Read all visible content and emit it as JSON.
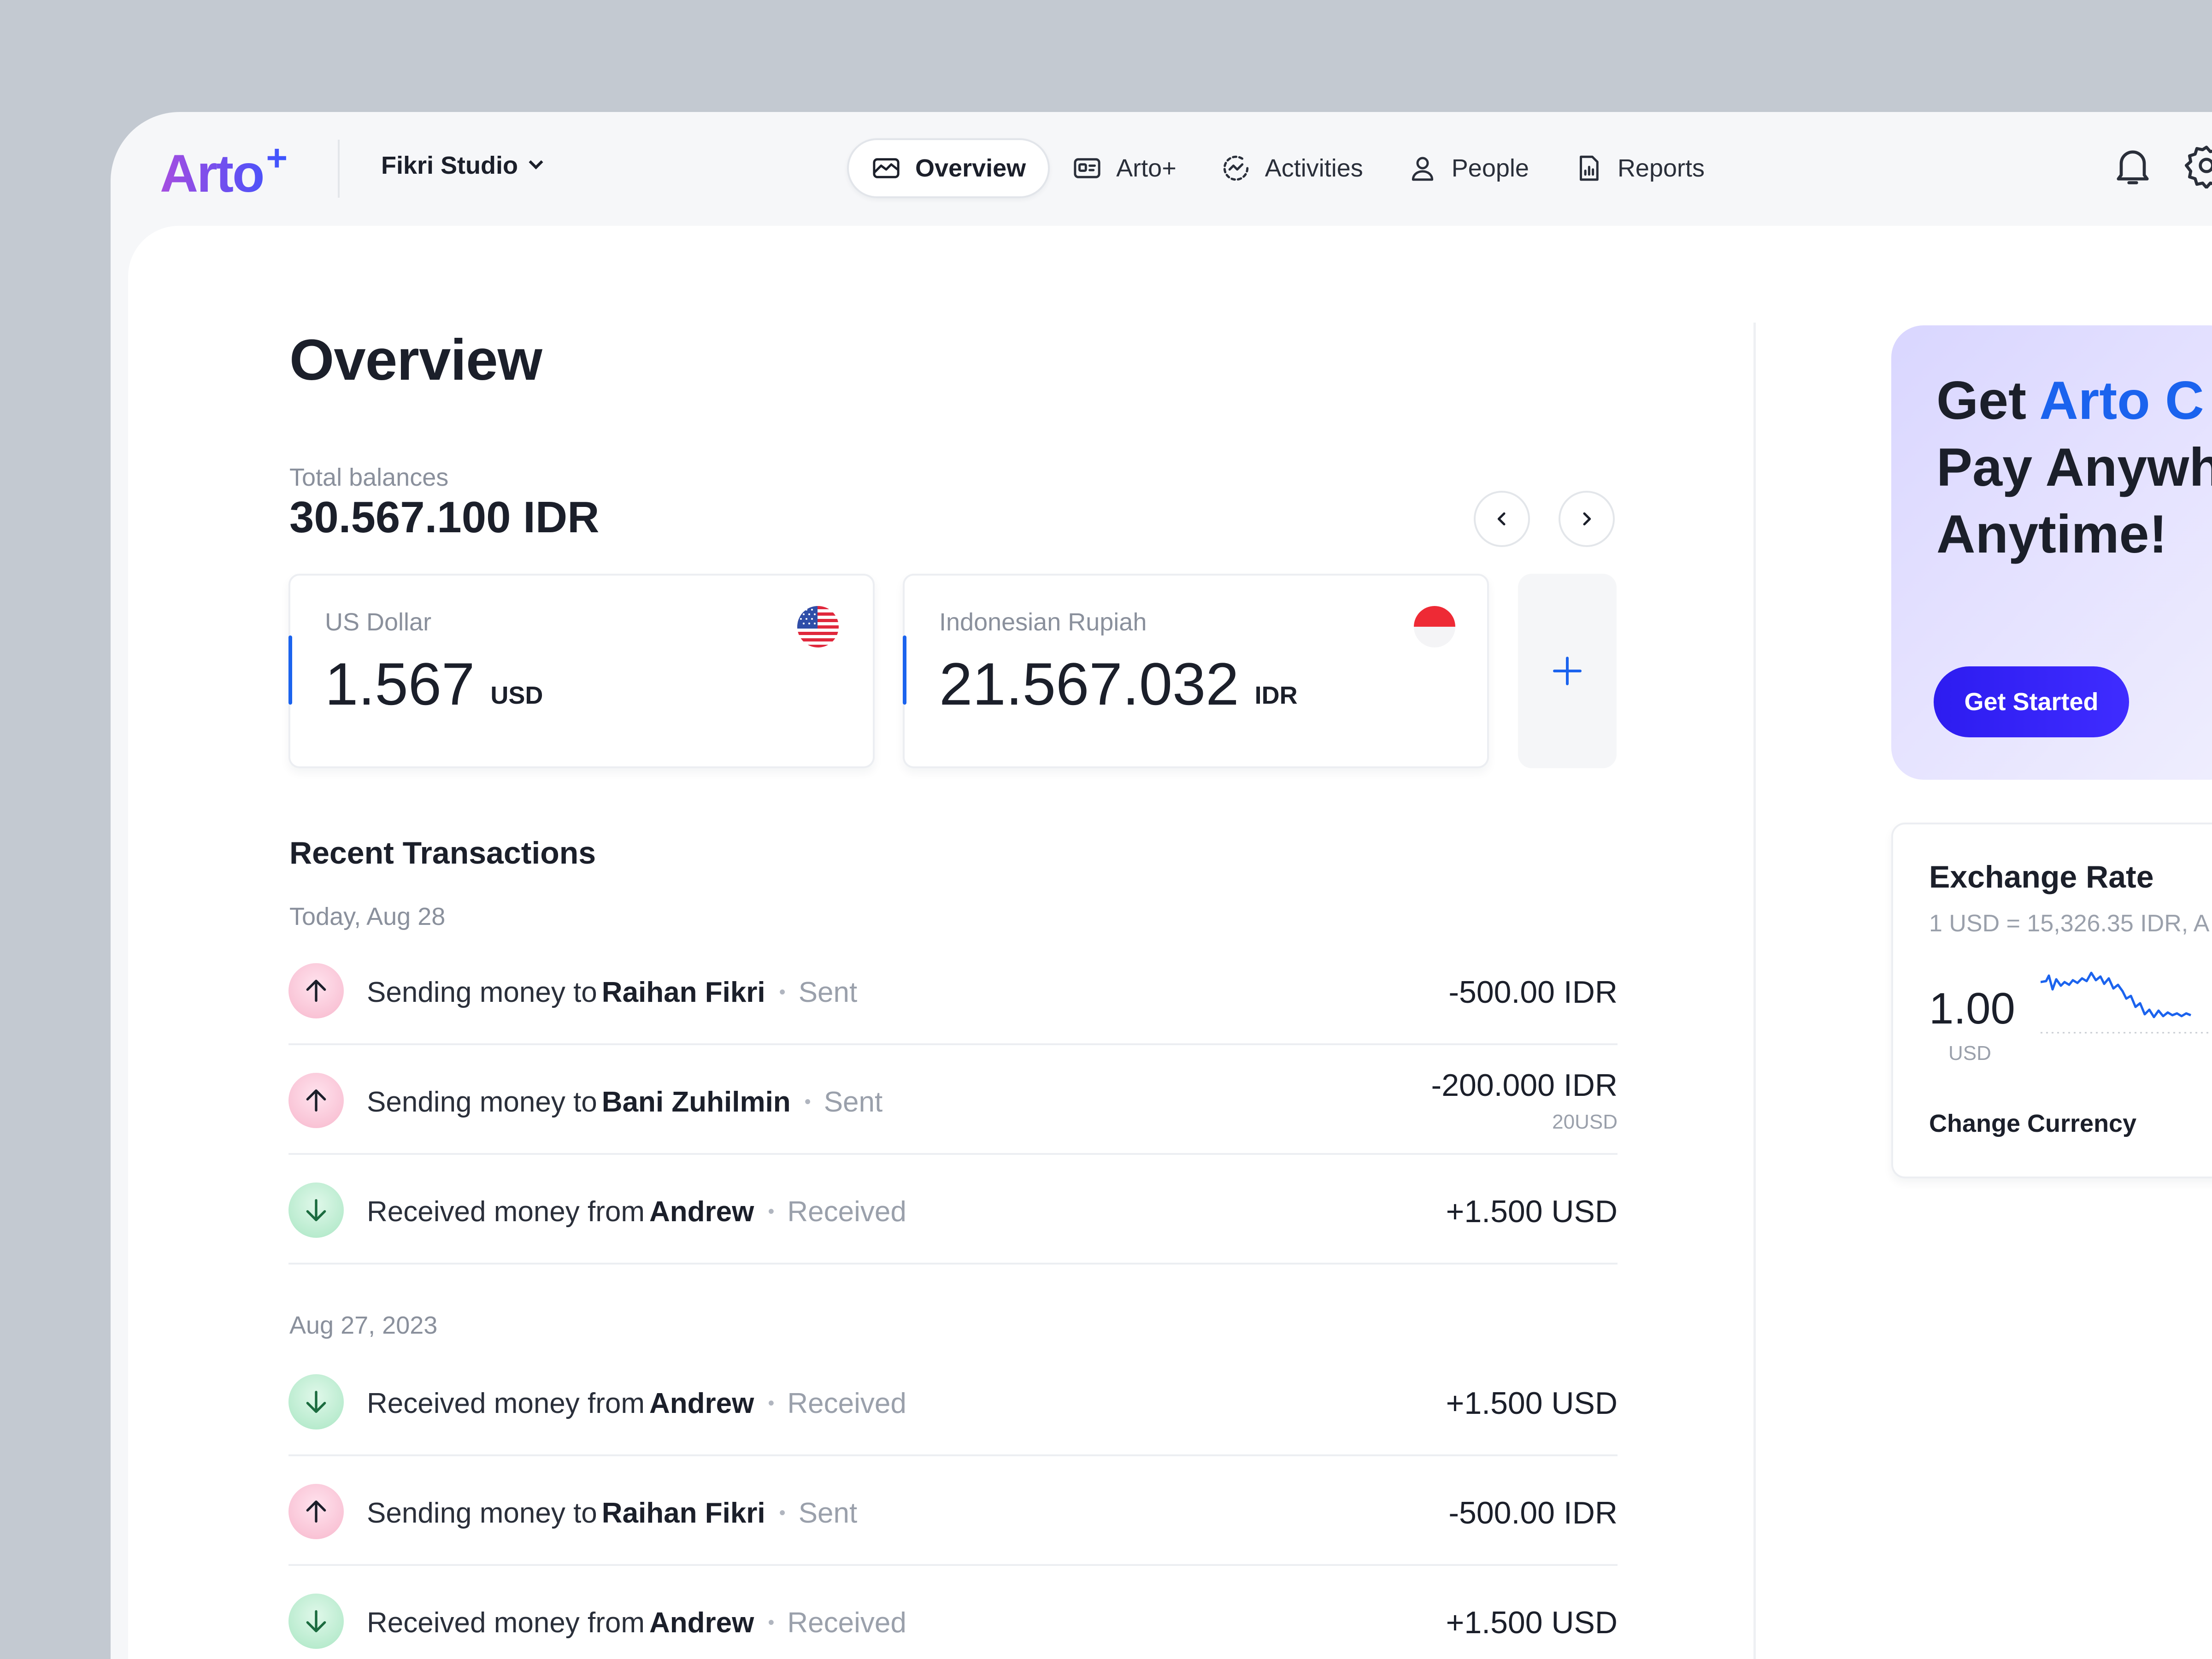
{
  "brand": {
    "name": "Arto",
    "mark": "+"
  },
  "workspace": {
    "name": "Fikri Studio"
  },
  "nav": {
    "items": [
      {
        "label": "Overview",
        "icon": "chart-area-icon",
        "active": true
      },
      {
        "label": "Arto+",
        "icon": "id-card-icon",
        "active": false
      },
      {
        "label": "Activities",
        "icon": "activity-icon",
        "active": false
      },
      {
        "label": "People",
        "icon": "user-icon",
        "active": false
      },
      {
        "label": "Reports",
        "icon": "report-icon",
        "active": false
      }
    ],
    "right_icons": [
      "bell-icon",
      "gear-icon"
    ]
  },
  "overview": {
    "title": "Overview",
    "balances_label": "Total balances",
    "balances_value": "30.567.100 IDR",
    "cards": [
      {
        "label": "US Dollar",
        "amount": "1.567",
        "unit": "USD",
        "flag": "us-flag-icon"
      },
      {
        "label": "Indonesian Rupiah",
        "amount": "21.567.032",
        "unit": "IDR",
        "flag": "indonesia-flag-icon"
      }
    ]
  },
  "transactions": {
    "title": "Recent Transactions",
    "groups": [
      {
        "date": "Today, Aug 28",
        "items": [
          {
            "type": "sent",
            "prefix": "Sending money to",
            "who": "Raihan Fikri",
            "status": "Sent",
            "amount": "-500.00 IDR",
            "sub": ""
          },
          {
            "type": "sent",
            "prefix": "Sending money to",
            "who": "Bani Zuhilmin",
            "status": "Sent",
            "amount": "-200.000 IDR",
            "sub": "20USD"
          },
          {
            "type": "recv",
            "prefix": "Received money from",
            "who": "Andrew",
            "status": "Received",
            "amount": "+1.500 USD",
            "sub": ""
          }
        ]
      },
      {
        "date": "Aug 27, 2023",
        "items": [
          {
            "type": "recv",
            "prefix": "Received money from",
            "who": "Andrew",
            "status": "Received",
            "amount": "+1.500 USD",
            "sub": ""
          },
          {
            "type": "sent",
            "prefix": "Sending money to",
            "who": "Raihan Fikri",
            "status": "Sent",
            "amount": "-500.00 IDR",
            "sub": ""
          },
          {
            "type": "recv",
            "prefix": "Received money from",
            "who": "Andrew",
            "status": "Received",
            "amount": "+1.500 USD",
            "sub": ""
          }
        ]
      }
    ]
  },
  "promo": {
    "line1_prefix": "Get",
    "line1_brand": "Arto C",
    "line2": "Pay Anywh",
    "line3": "Anytime!",
    "cta": "Get Started"
  },
  "exchange": {
    "title": "Exchange Rate",
    "subtitle": "1 USD = 15,326.35 IDR, A",
    "value": "1.00",
    "unit": "USD",
    "action": "Change Currency"
  },
  "colors": {
    "accent": "#1b63ee",
    "cta": "#2d1cf0",
    "sent_badge": "#f7b7cc",
    "received_badge": "#a9e6c3",
    "promo_bg": "#d9d6ff",
    "page_bg": "#c3c9d1"
  }
}
